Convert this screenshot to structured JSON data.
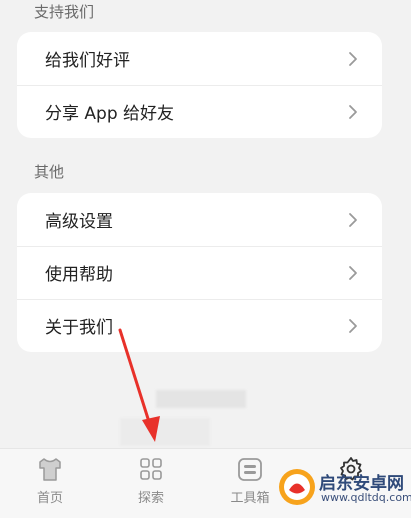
{
  "sections": [
    {
      "title": "支持我们",
      "items": [
        {
          "label": "给我们好评"
        },
        {
          "label": "分享 App 给好友"
        }
      ]
    },
    {
      "title": "其他",
      "items": [
        {
          "label": "高级设置"
        },
        {
          "label": "使用帮助"
        },
        {
          "label": "关于我们"
        }
      ]
    }
  ],
  "tabbar": {
    "items": [
      {
        "label": "首页",
        "icon": "shirt-icon"
      },
      {
        "label": "探索",
        "icon": "grid-icon"
      },
      {
        "label": "工具箱",
        "icon": "toolbox-icon"
      },
      {
        "label": "",
        "icon": "gear-icon"
      }
    ]
  },
  "watermark": {
    "brand": "启东安卓网",
    "url": "www.qdltdq.com"
  },
  "colors": {
    "background": "#f2f2f2",
    "card": "#ffffff",
    "arrow": "#e8312a"
  }
}
